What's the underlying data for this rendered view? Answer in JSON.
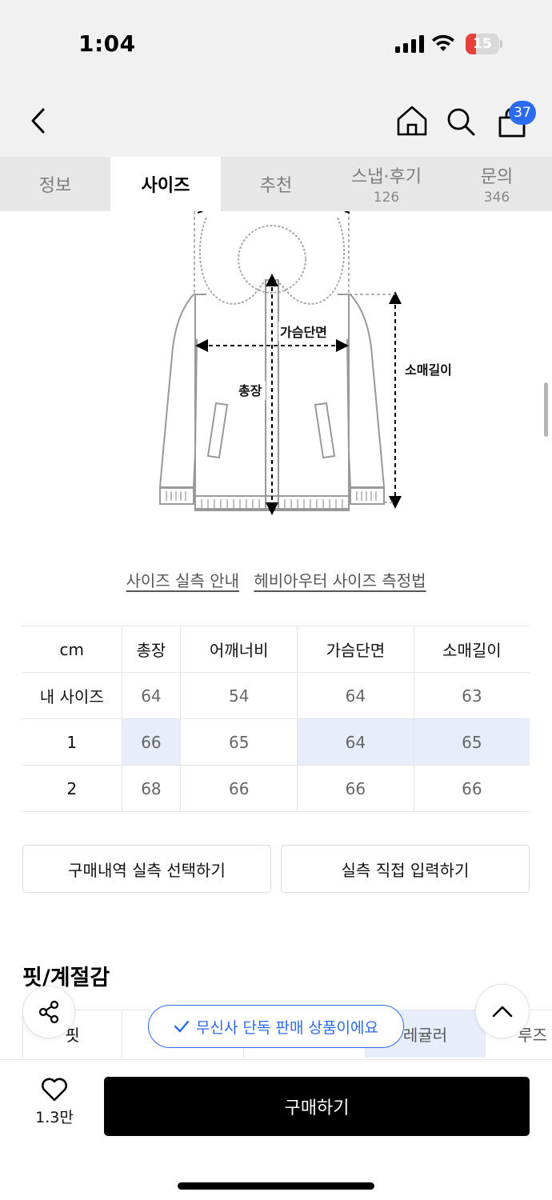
{
  "status": {
    "time": "1:04",
    "battery": "15"
  },
  "nav": {
    "cart_count": "37"
  },
  "tabs": [
    {
      "label": "정보",
      "sub": ""
    },
    {
      "label": "사이즈",
      "sub": ""
    },
    {
      "label": "추천",
      "sub": ""
    },
    {
      "label": "스냅·후기",
      "sub": "126"
    },
    {
      "label": "문의",
      "sub": "346"
    }
  ],
  "diagram": {
    "chest": "가슴단면",
    "length": "총장",
    "sleeve": "소매길이"
  },
  "guides": {
    "size_guide": "사이즈 실측 안내",
    "heavy_outer": "헤비아우터 사이즈 측정법"
  },
  "size_table": {
    "headers": [
      "cm",
      "총장",
      "어깨너비",
      "가슴단면",
      "소매길이"
    ],
    "rows": [
      [
        "내 사이즈",
        "64",
        "54",
        "64",
        "63"
      ],
      [
        "1",
        "66",
        "65",
        "64",
        "65"
      ],
      [
        "2",
        "68",
        "66",
        "66",
        "66"
      ]
    ]
  },
  "buttons": {
    "purchase_history": "구매내역 실측 선택하기",
    "manual_input": "실측 직접 입력하기"
  },
  "fit_section": {
    "title": "핏/계절감",
    "row_label": "핏",
    "regular": "레귤러",
    "loose": "루즈"
  },
  "exclusive_pill": "무신사 단독 판매 상품이에요",
  "bottom": {
    "likes": "1.3만",
    "buy_label": "구매하기"
  },
  "colors": {
    "accent": "#2b6bf2",
    "highlight": "#e8edfb",
    "battery_low": "#e8413b"
  }
}
